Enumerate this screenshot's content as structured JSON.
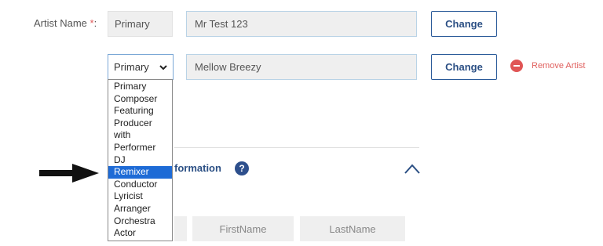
{
  "artist_name_label": "Artist Name",
  "required_marker": "*",
  "label_colon": ":",
  "row1": {
    "role": "Primary",
    "name_value": "Mr Test 123",
    "change_label": "Change"
  },
  "row2": {
    "role_selected": "Primary",
    "name_value": "Mellow Breezy",
    "change_label": "Change",
    "remove_label": "Remove Artist"
  },
  "role_options": [
    "Primary",
    "Composer",
    "Featuring",
    "Producer",
    "with",
    "Performer",
    "DJ",
    "Remixer",
    "Conductor",
    "Lyricist",
    "Arranger",
    "Orchestra",
    "Actor"
  ],
  "highlighted_option": "Remixer",
  "section": {
    "title_visible": "formation",
    "help_glyph": "?"
  },
  "person_fields": {
    "first_placeholder": "FirstName",
    "last_placeholder": "LastName"
  },
  "icons": {
    "chevron": "chevron-down-icon",
    "remove": "minus-circle-icon",
    "help": "question-circle-icon",
    "collapse": "chevron-up-icon",
    "pointer": "arrow-right-icon"
  },
  "colors": {
    "accent": "#2b4f84",
    "danger": "#e05555",
    "selection": "#1e6bd6"
  }
}
